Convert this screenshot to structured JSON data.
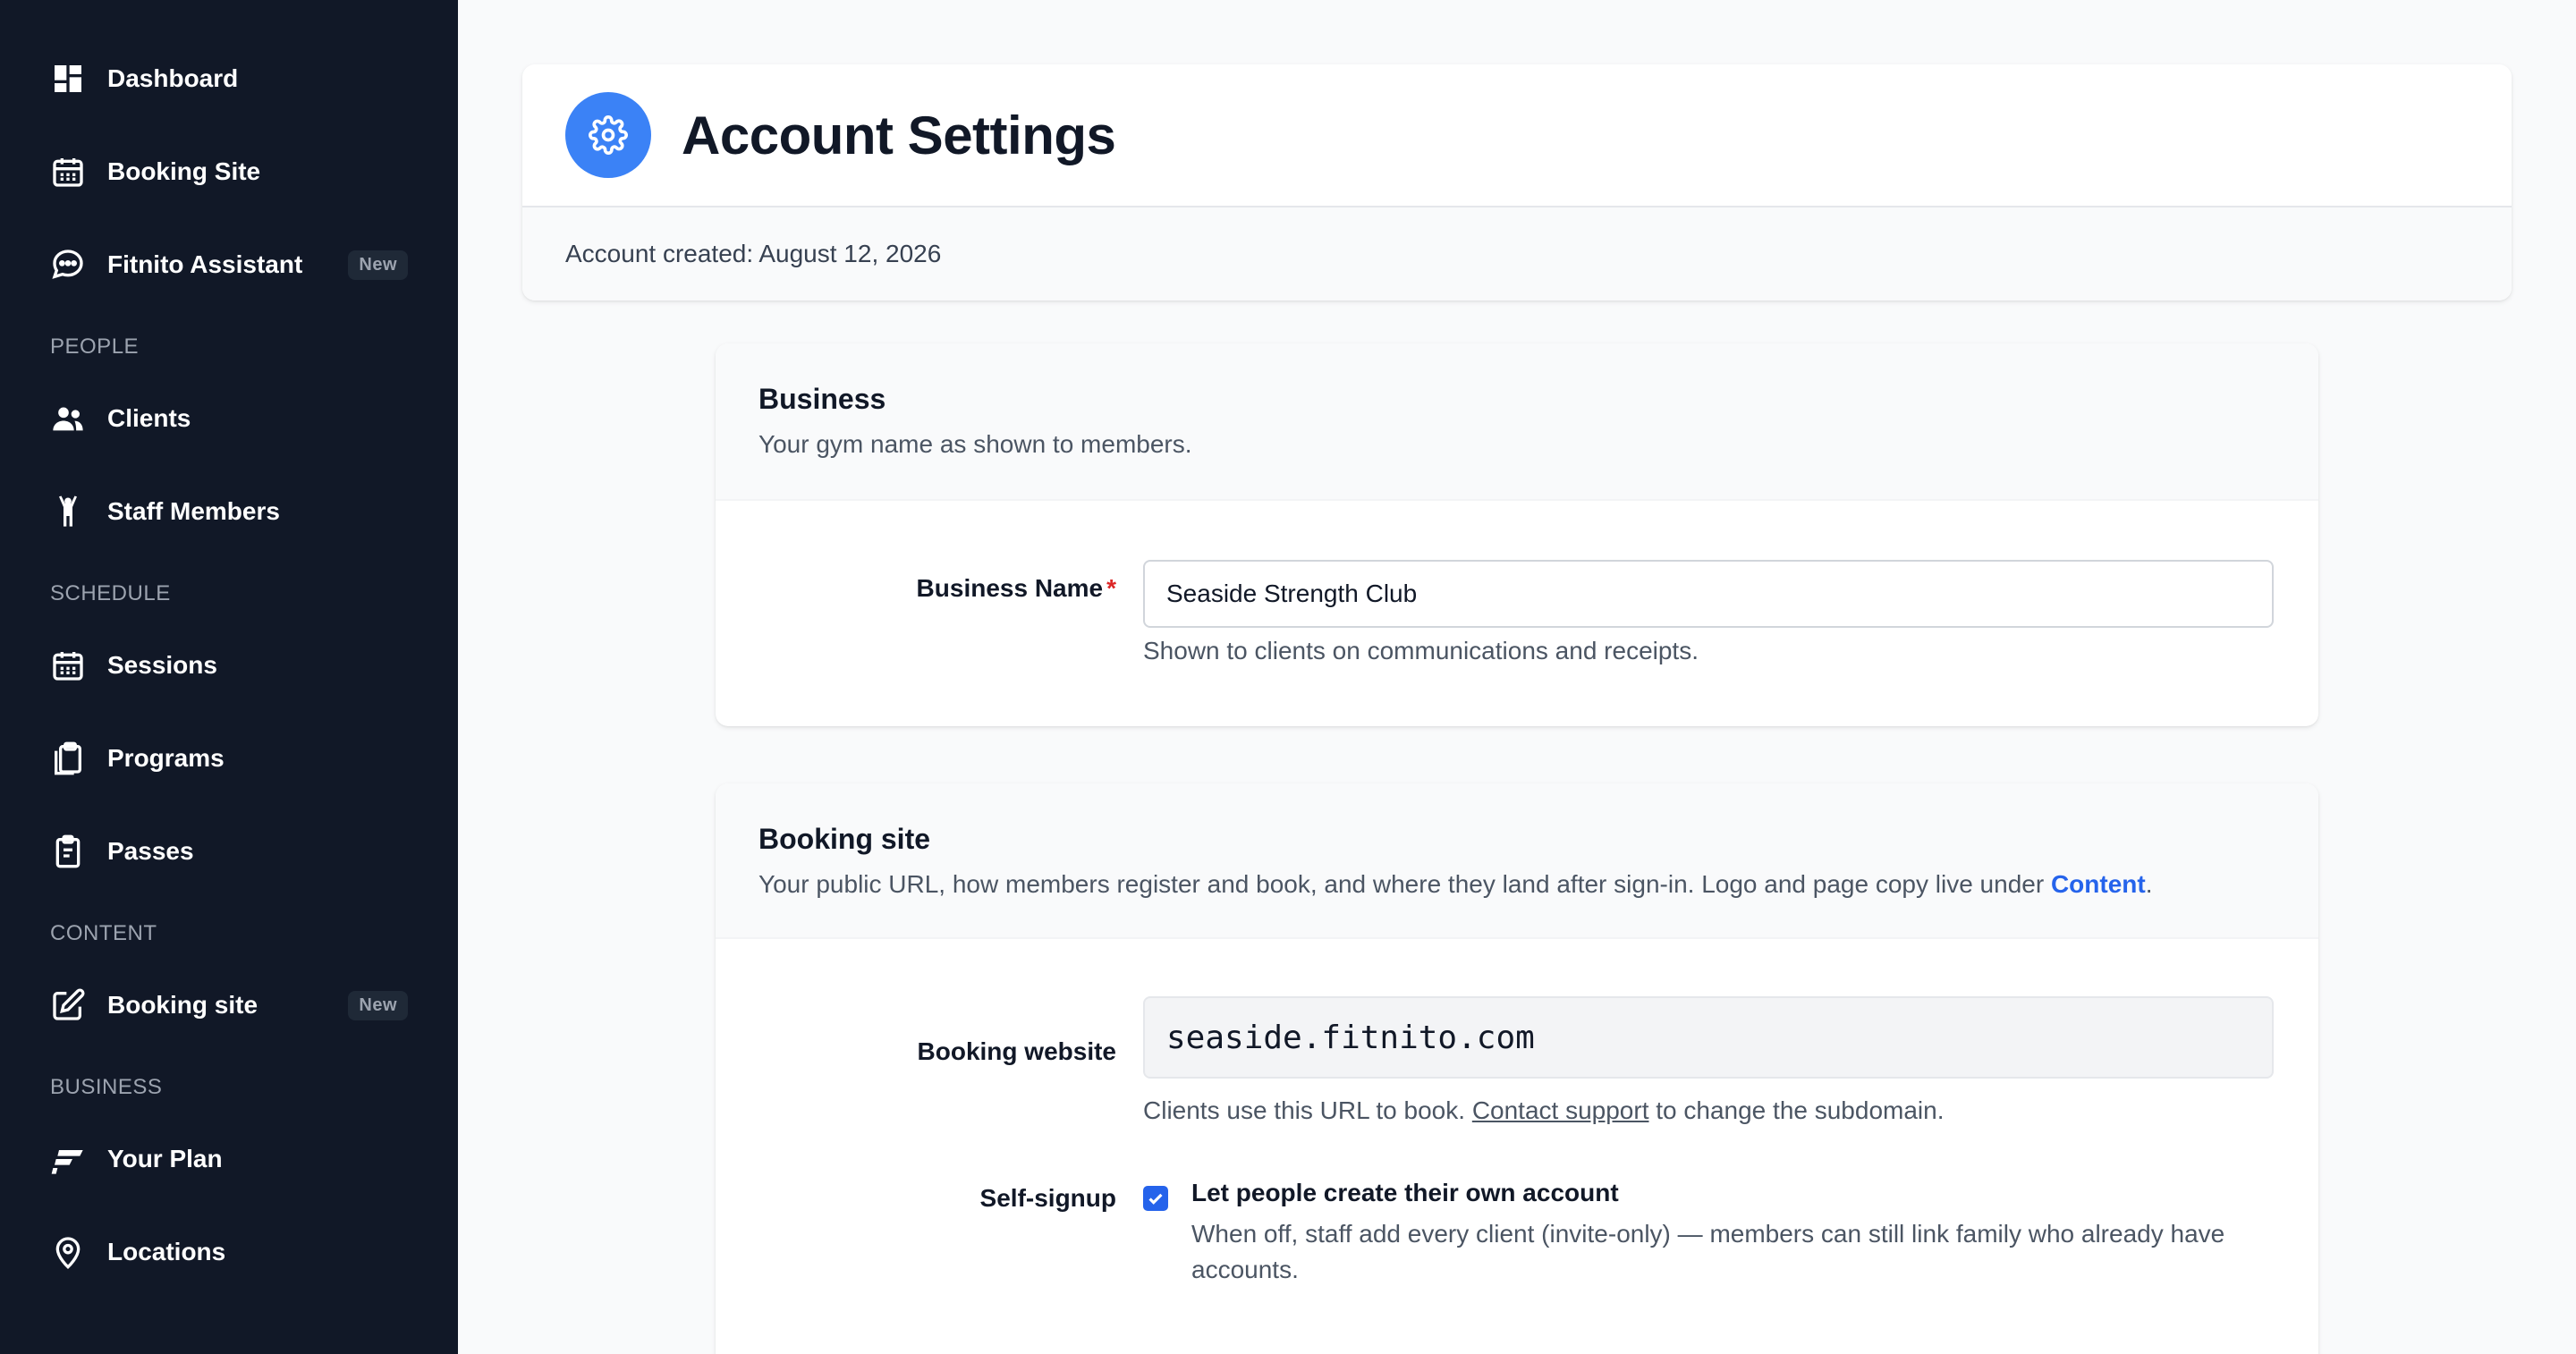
{
  "sidebar": {
    "items_top": [
      {
        "label": "Dashboard",
        "icon": "dashboard-icon"
      },
      {
        "label": "Booking Site",
        "icon": "calendar-icon"
      },
      {
        "label": "Fitnito Assistant",
        "icon": "chat-bubble-icon",
        "badge": "New"
      }
    ],
    "people": {
      "heading": "PEOPLE",
      "items": [
        {
          "label": "Clients",
          "icon": "users-icon"
        },
        {
          "label": "Staff Members",
          "icon": "person-arms-up-icon"
        }
      ]
    },
    "schedule": {
      "heading": "SCHEDULE",
      "items": [
        {
          "label": "Sessions",
          "icon": "calendar-icon"
        },
        {
          "label": "Programs",
          "icon": "clipboard-copy-icon"
        },
        {
          "label": "Passes",
          "icon": "clipboard-list-icon"
        }
      ]
    },
    "content": {
      "heading": "CONTENT",
      "items": [
        {
          "label": "Booking site",
          "icon": "edit-icon",
          "badge": "New"
        }
      ]
    },
    "business": {
      "heading": "BUSINESS",
      "items": [
        {
          "label": "Your Plan",
          "icon": "fitnito-logo-icon"
        },
        {
          "label": "Locations",
          "icon": "map-pin-icon"
        }
      ]
    }
  },
  "header": {
    "title": "Account Settings",
    "created": "Account created: August 12, 2026",
    "accent_color": "#3b82f6"
  },
  "business_section": {
    "title": "Business",
    "description": "Your gym name as shown to members.",
    "name_label": "Business Name",
    "required_mark": "*",
    "name_value": "Seaside Strength Club",
    "name_help": "Shown to clients on communications and receipts."
  },
  "booking_section": {
    "title": "Booking site",
    "description_prefix": "Your public URL, how members register and book, and where they land after sign-in. Logo and page copy live under ",
    "description_link": "Content",
    "description_suffix": ".",
    "website_label": "Booking website",
    "website_value": "seaside.fitnito.com",
    "website_help_prefix": "Clients use this URL to book. ",
    "website_help_link": "Contact support",
    "website_help_suffix": " to change the subdomain.",
    "signup_label": "Self-signup",
    "signup_checked": true,
    "signup_option": "Let people create their own account",
    "signup_help": "When off, staff add every client (invite-only) — members can still link family who already have accounts."
  }
}
